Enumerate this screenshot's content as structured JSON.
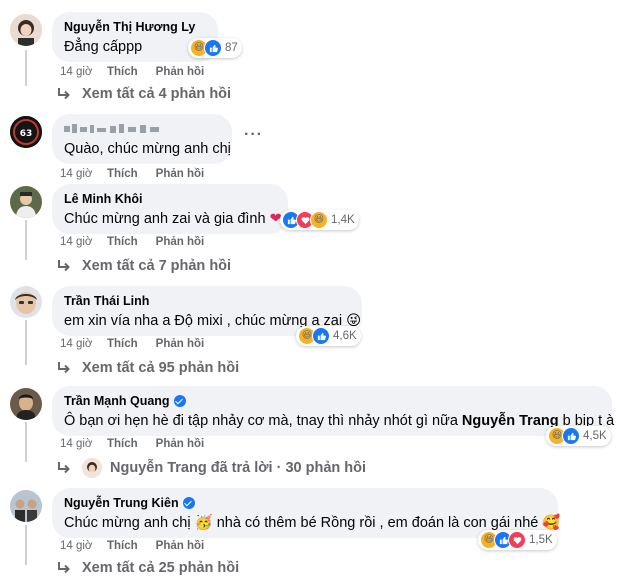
{
  "comments": [
    {
      "author": "Nguyễn Thị Hương Ly",
      "text": "Đẳng cấppp",
      "time": "14 giờ",
      "like": "Thích",
      "reply": "Phản hồi",
      "reaction_count": "87",
      "more_replies": "Xem tất cả 4 phản hồi"
    },
    {
      "author": "",
      "text": "Quào, chúc mừng anh chị",
      "time": "14 giờ",
      "like": "Thích",
      "reply": "Phản hồi",
      "more_options": "···"
    },
    {
      "author": "Lê Minh Khôi",
      "text": "Chúc mừng anh zai và gia đình",
      "time": "14 giờ",
      "like": "Thích",
      "reply": "Phản hồi",
      "reaction_count": "1,4K",
      "more_replies": "Xem tất cả 7 phản hồi"
    },
    {
      "author": "Trần Thái Linh",
      "text": "em xin vía nha a Độ mixi , chúc mừng a zai",
      "time": "14 giờ",
      "like": "Thích",
      "reply": "Phản hồi",
      "reaction_count": "4,6K",
      "more_replies": "Xem tất cả 95 phản hồi"
    },
    {
      "author": "Trần Mạnh Quang",
      "text_before": "Ô bạn ơi hẹn hè đi tập nhảy cơ mà, tnay thì nhảy nhót gì nữa ",
      "mention": "Nguyễn Trang",
      "text_after": " b bịp t à",
      "time": "14 giờ",
      "like": "Thích",
      "reply": "Phản hồi",
      "reaction_count": "4,5K",
      "reply_summary": "Nguyễn Trang đã trả lời · 30 phản hồi"
    },
    {
      "author": "Nguyễn Trung Kiên",
      "text_before": "Chúc mừng anh chị",
      "text_after": " nhà có thêm bé Rồng rồi , em đoán là con gái nhé",
      "time": "14 giờ",
      "like": "Thích",
      "reply": "Phản hồi",
      "reaction_count": "1,5K",
      "more_replies": "Xem tất cả 25 phản hồi"
    }
  ],
  "colors": {
    "bubble": "#f0f2f5",
    "secondary_text": "#65676b",
    "like_blue": "#1877f2",
    "love_red": "#f33e58",
    "haha_yellow": "#f7b125"
  },
  "icons": [
    "haha-icon",
    "like-icon",
    "love-icon",
    "red-heart-emoji",
    "winking-tongue-emoji",
    "partying-face-emoji",
    "smiling-hearts-emoji",
    "reply-arrow-icon",
    "verified-badge-icon"
  ]
}
